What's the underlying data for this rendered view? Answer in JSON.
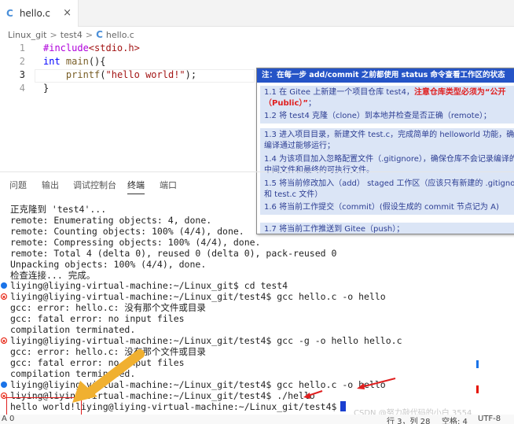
{
  "tab": {
    "icon": "C",
    "label": "hello.c",
    "close": "×"
  },
  "breadcrumb": {
    "root": "Linux_git",
    "folder": "test4",
    "file": "hello.c",
    "sep": ">",
    "icon": "C"
  },
  "editor": {
    "line_numbers": [
      "1",
      "2",
      "3",
      "4"
    ],
    "line1": {
      "directive": "#include",
      "header": "<stdio.h>"
    },
    "line2": {
      "kw": "int",
      "fn": "main",
      "rest": "(){"
    },
    "line3": {
      "indent": "    ",
      "fn": "printf",
      "open": "(",
      "str": "\"hello world!\"",
      "close": ");"
    },
    "line4": {
      "text": "}"
    }
  },
  "note": {
    "title": "注：在每一步 add/commit 之前都使用 status 命令查看工作区的状态",
    "items": [
      {
        "a": "1.1 在 Gitee 上新建一个项目仓库 test4，",
        "red": "注意仓库类型必须为“公开（Public）”",
        "b": "；"
      },
      {
        "a": "1.2 将 test4 克隆（clone）到本地并检查是否正确（remote）；"
      },
      {
        "a": "1.3 进入项目目录，新建文件 test.c，完成简单的 helloworld 功能，确保编译通过能够运行；"
      },
      {
        "a": "1.4 为该项目加入忽略配置文件（.gitignore），确保仓库不会记录编译的中间文件和最终的可执行文件。"
      },
      {
        "a": "1.5 将当前修改加入（add） staged 工作区（应该只有新建的 .gitignore 和 test.c 文件）"
      },
      {
        "a": "1.6 将当前工作提交（commit）(假设生成的 commit 节点记为 A)"
      },
      {
        "a": "1.7 将当前工作推送到 Gitee（push）；"
      }
    ]
  },
  "panel_tabs": [
    "问题",
    "输出",
    "调试控制台",
    "终端",
    "端口"
  ],
  "terminal": {
    "lines": [
      "正克隆到 'test4'...",
      "remote: Enumerating objects: 4, done.",
      "remote: Counting objects: 100% (4/4), done.",
      "remote: Compressing objects: 100% (4/4), done.",
      "remote: Total 4 (delta 0), reused 0 (delta 0), pack-reused 0",
      "Unpacking objects: 100% (4/4), done.",
      "检查连接... 完成。",
      "liying@liying-virtual-machine:~/Linux_git$ cd test4",
      "liying@liying-virtual-machine:~/Linux_git/test4$ gcc hello.c -o hello",
      "gcc: error: hello.c: 没有那个文件或目录",
      "gcc: fatal error: no input files",
      "compilation terminated.",
      "liying@liying-virtual-machine:~/Linux_git/test4$ gcc -g -o hello hello.c",
      "gcc: error: hello.c: 没有那个文件或目录",
      "gcc: fatal error: no input files",
      "compilation terminated.",
      "liying@liying-virtual-machine:~/Linux_git/test4$ gcc hello.c -o hello",
      "liying@liying-virtual-machine:~/Linux_git/test4$ ./hello",
      "hello world!liying@liying-virtual-machine:~/Linux_git/test4$"
    ]
  },
  "status": {
    "left": "A 0",
    "position": "行 3，列 28",
    "spaces": "空格: 4",
    "encoding": "UTF-8"
  },
  "watermark": "CSDN @努力敲代码的小白 3554",
  "colors": {
    "accent": "#1a73e8",
    "error": "#e51400",
    "note_title": "#2554c7",
    "note_item_bg": "#dbe5f6",
    "arrow": "#f0b030"
  }
}
